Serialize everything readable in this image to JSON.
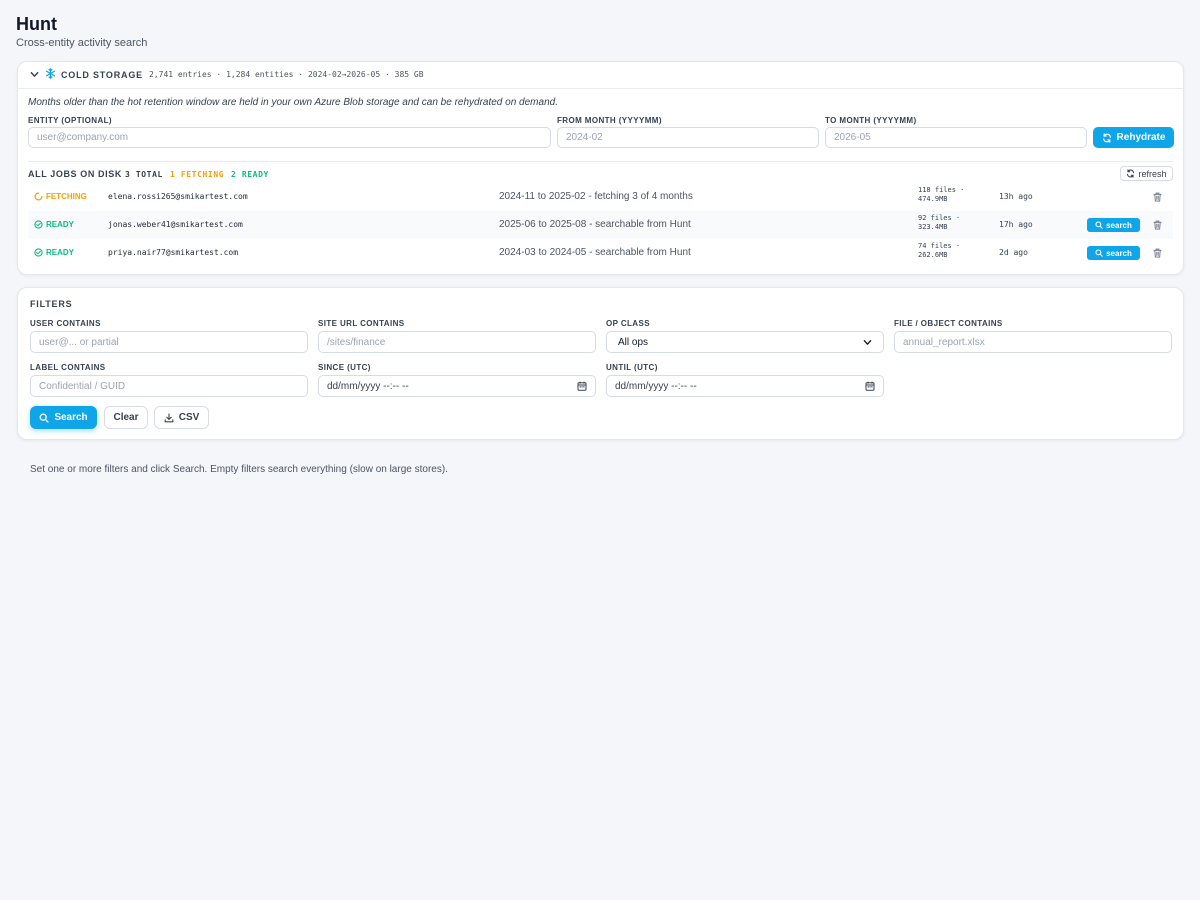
{
  "page": {
    "title": "Hunt",
    "subtitle": "Cross-entity activity search",
    "hint": "Set one or more filters and click Search. Empty filters search everything (slow on large stores)."
  },
  "colors": {
    "accent": "#0ea5e9",
    "fetching": "#f59e0b",
    "ready": "#10b981"
  },
  "cold_storage": {
    "title": "COLD STORAGE",
    "stats": "2,741 entries · 1,284 entities · 2024-02→2026-05 · 385 GB",
    "note": "Months older than the hot retention window are held in your own Azure Blob storage and can be rehydrated on demand.",
    "icons": {
      "toggle": "chevron-down-icon",
      "brand": "snowflake-icon"
    },
    "entity": {
      "label": "ENTITY (OPTIONAL)",
      "placeholder": "user@company.com",
      "value": ""
    },
    "from_month": {
      "label": "FROM MONTH (YYYYMM)",
      "placeholder": "2024-02",
      "value": ""
    },
    "to_month": {
      "label": "TO MONTH (YYYYMM)",
      "placeholder": "2026-05",
      "value": ""
    },
    "rehydrate_label": "Rehydrate",
    "jobs": {
      "title": "ALL JOBS ON DISK",
      "total": "3 TOTAL",
      "fetching": "1 FETCHING",
      "ready": "2 READY",
      "refresh_label": "refresh",
      "rows": [
        {
          "status": "FETCHING",
          "email": "elena.rossi265@smikartest.com",
          "description": "2024-11 to 2025-02 - fetching 3 of 4 months",
          "files": "118 files ·",
          "size": "474.9MB",
          "age": "13h ago",
          "search_label": ""
        },
        {
          "status": "READY",
          "email": "jonas.weber41@smikartest.com",
          "description": "2025-06 to 2025-08 - searchable from Hunt",
          "files": "92 files ·",
          "size": "323.4MB",
          "age": "17h ago",
          "search_label": "search"
        },
        {
          "status": "READY",
          "email": "priya.nair77@smikartest.com",
          "description": "2024-03 to 2024-05 - searchable from Hunt",
          "files": "74 files ·",
          "size": "262.6MB",
          "age": "2d ago",
          "search_label": "search"
        }
      ]
    }
  },
  "filters": {
    "title": "FILTERS",
    "user": {
      "label": "USER CONTAINS",
      "placeholder": "user@... or partial",
      "value": ""
    },
    "site_url": {
      "label": "SITE URL CONTAINS",
      "placeholder": "/sites/finance",
      "value": ""
    },
    "op_class": {
      "label": "OP CLASS",
      "selected": "All ops"
    },
    "file_object": {
      "label": "FILE / OBJECT CONTAINS",
      "placeholder": "annual_report.xlsx",
      "value": ""
    },
    "label_field": {
      "label": "LABEL CONTAINS",
      "placeholder": "Confidential / GUID",
      "value": ""
    },
    "since": {
      "label": "SINCE (UTC)",
      "value": "dd/mm/yyyy --:-- --"
    },
    "until": {
      "label": "UNTIL (UTC)",
      "value": "dd/mm/yyyy --:-- --"
    },
    "search_label": "Search",
    "clear_label": "Clear",
    "csv_label": "CSV"
  }
}
